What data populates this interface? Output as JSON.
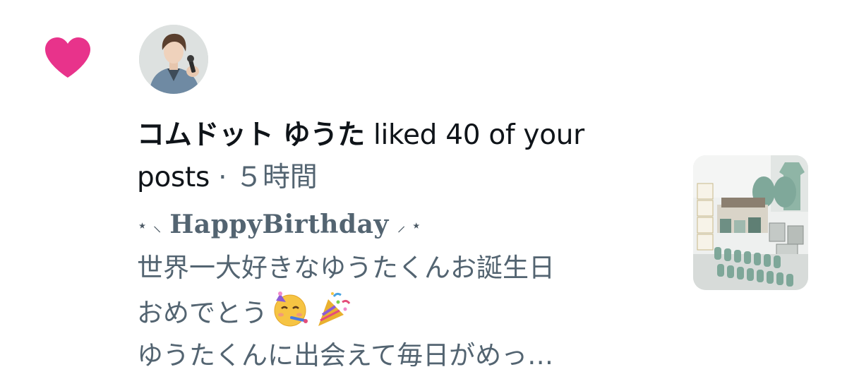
{
  "notification": {
    "icon": "heart-icon",
    "accent_color": "#e8338b",
    "user_name": "コムドット ゆうた",
    "action_text": " liked 40 of your posts",
    "separator": " · ",
    "timestamp": "５時間",
    "post_preview": {
      "sparkle_left": "⋆ ⸜",
      "title": "HappyBirthday",
      "sparkle_right": "⸝ ⋆",
      "line2": "世界一大好きなゆうたくんお誕生日",
      "line3": "おめでとう",
      "line3_emojis": [
        "partying-face-emoji",
        "party-popper-emoji"
      ],
      "line4": "ゆうたくんに出会えて毎日がめっ…"
    },
    "thumbnail_icon": "birthday-decoration-photo"
  }
}
